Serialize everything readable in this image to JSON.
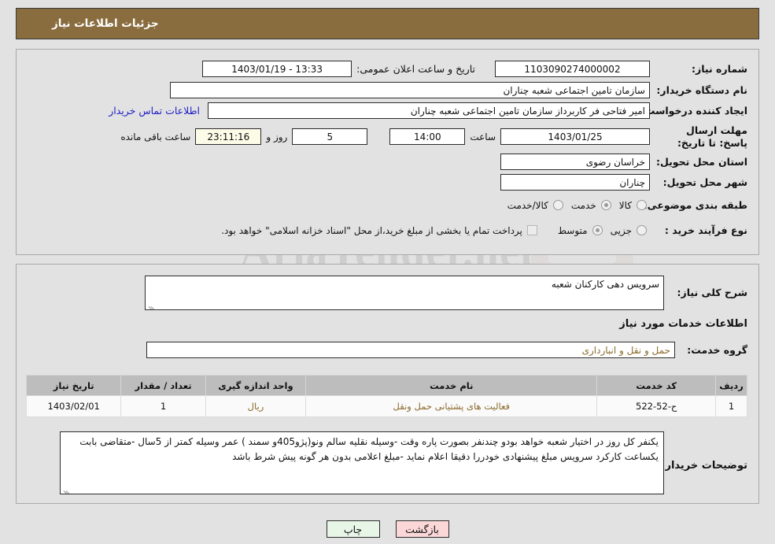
{
  "header": {
    "title": "جزئیات اطلاعات نیاز"
  },
  "watermark": {
    "text": "AriaTender.net"
  },
  "form": {
    "need_number": {
      "label": "شماره نیاز:",
      "value": "1103090274000002"
    },
    "announce_datetime": {
      "label": "تاریخ و ساعت اعلان عمومی:",
      "value": "13:33 - 1403/01/19"
    },
    "buyer_org": {
      "label": "نام دستگاه خریدار:",
      "value": "سازمان تامین اجتماعی شعبه چناران"
    },
    "requester": {
      "label": "ایجاد کننده درخواست:",
      "value": "امیر فتاحی فر کاربرداز سازمان تامین اجتماعی شعبه چناران"
    },
    "buyer_contact_link": "اطلاعات تماس خریدار",
    "deadline": {
      "label": "مهلت ارسال پاسخ: تا تاریخ:",
      "value": "1403/01/25"
    },
    "deadline_hour_label": "ساعت",
    "deadline_hour": "14:00",
    "remaining_days": "5",
    "days_and_label": "روز و",
    "remaining_time": "23:11:16",
    "remaining_suffix": "ساعت باقی مانده",
    "province": {
      "label": "استان محل تحویل:",
      "value": "خراسان رضوی"
    },
    "city": {
      "label": "شهر محل تحویل:",
      "value": "چناران"
    },
    "category": {
      "label": "طبقه بندی موضوعی:",
      "options": [
        {
          "label": "کالا",
          "selected": false
        },
        {
          "label": "خدمت",
          "selected": true
        },
        {
          "label": "کالا/خدمت",
          "selected": false
        }
      ]
    },
    "purchase_type": {
      "label": "نوع فرآیند خرید :",
      "options": [
        {
          "label": "جزیی",
          "selected": false
        },
        {
          "label": "متوسط",
          "selected": true
        }
      ],
      "treasury_note": "پرداخت تمام یا بخشی از مبلغ خرید،از محل \"اسناد خزانه اسلامی\" خواهد بود.",
      "treasury_checked": false
    }
  },
  "details": {
    "summary": {
      "label": "شرح کلی نیاز:",
      "value": "سرویس دهی کارکنان شعبه"
    },
    "section_title": "اطلاعات خدمات مورد نیاز",
    "service_group": {
      "label": "گروه خدمت:",
      "value": "حمل و نقل و انبارداری"
    },
    "table": {
      "columns": [
        "ردیف",
        "کد خدمت",
        "نام خدمت",
        "واحد اندازه گیری",
        "تعداد / مقدار",
        "تاریخ نیاز"
      ],
      "rows": [
        {
          "row": "1",
          "code": "ح-52-522",
          "name": "فعالیت های پشتیانی حمل ونقل",
          "unit": "ریال",
          "qty": "1",
          "date": "1403/02/01"
        }
      ]
    },
    "buyer_notes": {
      "label": "توضیحات خریدار:",
      "value": "یکنفر کل روز در اختیار شعبه خواهد بودو چندنفر بصورت پاره وقت -وسیله نقلیه سالم ونو(پژو405و سمند ) عمر وسیله کمتر از 5سال -متقاضی بابت یکساعت کارکرد سرویس مبلغ پیشنهادی خودررا دقیقا اعلام نماید -مبلغ اعلامی بدون هر گونه پیش شرط باشد"
    }
  },
  "footer": {
    "print_label": "چاپ",
    "return_label": "بازگشت"
  }
}
